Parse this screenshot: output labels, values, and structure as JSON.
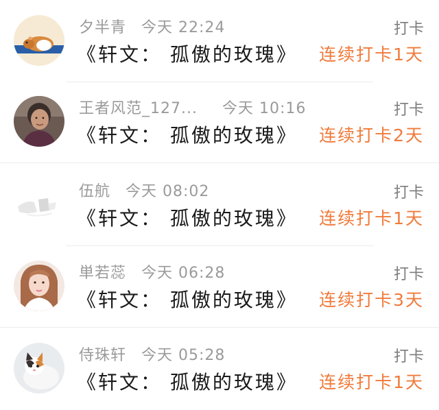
{
  "colors": {
    "streak": "#f07a3a",
    "meta": "#9a9a9a",
    "title": "#1a1a1a"
  },
  "entries": [
    {
      "name": "夕半青",
      "time": "今天 22:24",
      "title": "《轩文： 孤傲的玫瑰》",
      "checkin": "打卡",
      "streak": "连续打卡1天",
      "avatar": "hamster-avatar"
    },
    {
      "name": "王者风范_127...",
      "time": "今天 10:16",
      "title": "《轩文： 孤傲的玫瑰》",
      "checkin": "打卡",
      "streak": "连续打卡2天",
      "avatar": "elderly-woman-avatar"
    },
    {
      "name": "伍航",
      "time": "今天 08:02",
      "title": "《轩文： 孤傲的玫瑰》",
      "checkin": "打卡",
      "streak": "连续打卡1天",
      "avatar": "faded-scene-avatar"
    },
    {
      "name": "単若蕊",
      "time": "今天 06:28",
      "title": "《轩文： 孤傲的玫瑰》",
      "checkin": "打卡",
      "streak": "连续打卡3天",
      "avatar": "young-woman-avatar"
    },
    {
      "name": "侍珠轩",
      "time": "今天 05:28",
      "title": "《轩文： 孤傲的玫瑰》",
      "checkin": "打卡",
      "streak": "连续打卡1天",
      "avatar": "kitten-avatar"
    }
  ]
}
